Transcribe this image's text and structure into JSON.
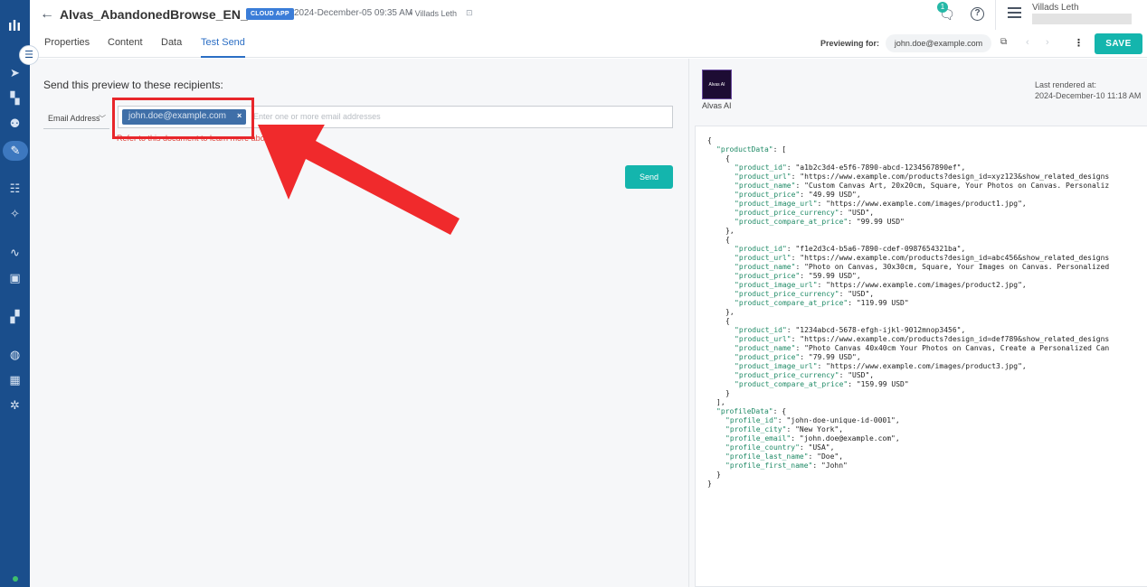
{
  "header": {
    "title": "Alvas_AbandonedBrowse_EN_2820",
    "badge": "CLOUD APP",
    "date": "2024-December-05 09:35 AM",
    "user": "• Villads Leth",
    "notification_count": "1",
    "help": "?",
    "account_name": "Villads Leth"
  },
  "tabs": [
    "Properties",
    "Content",
    "Data",
    "Test Send"
  ],
  "preview_bar": {
    "label": "Previewing for:",
    "email": "john.doe@example.com",
    "save_label": "SAVE"
  },
  "test_send": {
    "heading": "Send this preview to these recipients:",
    "type_select": "Email Address",
    "chip_email": "john.doe@example.com",
    "chip_remove": "×",
    "placeholder": "Enter one or more email addresses",
    "hint": "Refer to this document to learn more about identifiers",
    "send_label": "Send"
  },
  "preview": {
    "logo_text": "Alvas AI",
    "sender_name": "Alvas AI",
    "rendered_label": "Last rendered at:",
    "rendered_date": "2024-December-10 11:18 AM"
  },
  "json_preview": [
    {
      "indent": 0,
      "key": "",
      "rest": "{"
    },
    {
      "indent": 1,
      "key": "\"productData\"",
      "rest": ": ["
    },
    {
      "indent": 2,
      "key": "",
      "rest": "{"
    },
    {
      "indent": 3,
      "key": "\"product_id\"",
      "rest": ": \"a1b2c3d4-e5f6-7890-abcd-1234567890ef\","
    },
    {
      "indent": 3,
      "key": "\"product_url\"",
      "rest": ": \"https://www.example.com/products?design_id=xyz123&show_related_designs"
    },
    {
      "indent": 3,
      "key": "\"product_name\"",
      "rest": ": \"Custom Canvas Art, 20x20cm, Square, Your Photos on Canvas. Personaliz"
    },
    {
      "indent": 3,
      "key": "\"product_price\"",
      "rest": ": \"49.99 USD\","
    },
    {
      "indent": 3,
      "key": "\"product_image_url\"",
      "rest": ": \"https://www.example.com/images/product1.jpg\","
    },
    {
      "indent": 3,
      "key": "\"product_price_currency\"",
      "rest": ": \"USD\","
    },
    {
      "indent": 3,
      "key": "\"product_compare_at_price\"",
      "rest": ": \"99.99 USD\""
    },
    {
      "indent": 2,
      "key": "",
      "rest": "},"
    },
    {
      "indent": 2,
      "key": "",
      "rest": "{"
    },
    {
      "indent": 3,
      "key": "\"product_id\"",
      "rest": ": \"f1e2d3c4-b5a6-7890-cdef-0987654321ba\","
    },
    {
      "indent": 3,
      "key": "\"product_url\"",
      "rest": ": \"https://www.example.com/products?design_id=abc456&show_related_designs"
    },
    {
      "indent": 3,
      "key": "\"product_name\"",
      "rest": ": \"Photo on Canvas, 30x30cm, Square, Your Images on Canvas. Personalized"
    },
    {
      "indent": 3,
      "key": "\"product_price\"",
      "rest": ": \"59.99 USD\","
    },
    {
      "indent": 3,
      "key": "\"product_image_url\"",
      "rest": ": \"https://www.example.com/images/product2.jpg\","
    },
    {
      "indent": 3,
      "key": "\"product_price_currency\"",
      "rest": ": \"USD\","
    },
    {
      "indent": 3,
      "key": "\"product_compare_at_price\"",
      "rest": ": \"119.99 USD\""
    },
    {
      "indent": 2,
      "key": "",
      "rest": "},"
    },
    {
      "indent": 2,
      "key": "",
      "rest": "{"
    },
    {
      "indent": 3,
      "key": "\"product_id\"",
      "rest": ": \"1234abcd-5678-efgh-ijkl-9012mnop3456\","
    },
    {
      "indent": 3,
      "key": "\"product_url\"",
      "rest": ": \"https://www.example.com/products?design_id=def789&show_related_designs"
    },
    {
      "indent": 3,
      "key": "\"product_name\"",
      "rest": ": \"Photo Canvas 40x40cm Your Photos on Canvas, Create a Personalized Can"
    },
    {
      "indent": 3,
      "key": "\"product_price\"",
      "rest": ": \"79.99 USD\","
    },
    {
      "indent": 3,
      "key": "\"product_image_url\"",
      "rest": ": \"https://www.example.com/images/product3.jpg\","
    },
    {
      "indent": 3,
      "key": "\"product_price_currency\"",
      "rest": ": \"USD\","
    },
    {
      "indent": 3,
      "key": "\"product_compare_at_price\"",
      "rest": ": \"159.99 USD\""
    },
    {
      "indent": 2,
      "key": "",
      "rest": "}"
    },
    {
      "indent": 1,
      "key": "",
      "rest": "],"
    },
    {
      "indent": 1,
      "key": "\"profileData\"",
      "rest": ": {"
    },
    {
      "indent": 2,
      "key": "\"profile_id\"",
      "rest": ": \"john-doe-unique-id-0001\","
    },
    {
      "indent": 2,
      "key": "\"profile_city\"",
      "rest": ": \"New York\","
    },
    {
      "indent": 2,
      "key": "\"profile_email\"",
      "rest": ": \"john.doe@example.com\","
    },
    {
      "indent": 2,
      "key": "\"profile_country\"",
      "rest": ": \"USA\","
    },
    {
      "indent": 2,
      "key": "\"profile_last_name\"",
      "rest": ": \"Doe\","
    },
    {
      "indent": 2,
      "key": "\"profile_first_name\"",
      "rest": ": \"John\""
    },
    {
      "indent": 1,
      "key": "",
      "rest": "}"
    },
    {
      "indent": 0,
      "key": "",
      "rest": "}"
    }
  ],
  "sidebar": {
    "icons": [
      "campaign-icon",
      "content-icon",
      "audience-icon",
      "design-icon",
      "filters-icon",
      "magic-icon",
      "analytics-icon",
      "monitor-icon",
      "apps-icon",
      "global-icon",
      "qr-icon",
      "settings-icon"
    ]
  },
  "colors": {
    "rail": "#1a4e8c",
    "accent": "#14b5ad",
    "link": "#2b6ec4",
    "highlight": "#e8262b"
  }
}
